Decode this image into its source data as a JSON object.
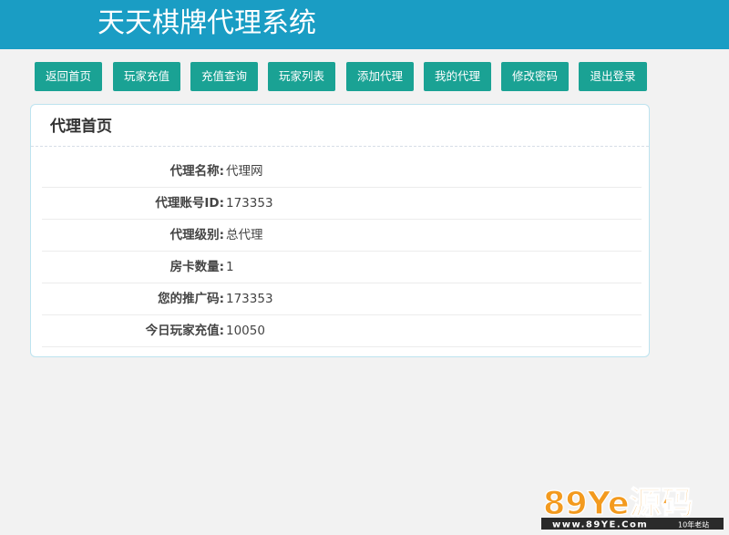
{
  "header": {
    "title": "天天棋牌代理系统"
  },
  "nav": {
    "items": [
      {
        "label": "返回首页"
      },
      {
        "label": "玩家充值"
      },
      {
        "label": "充值查询"
      },
      {
        "label": "玩家列表"
      },
      {
        "label": "添加代理"
      },
      {
        "label": "我的代理"
      },
      {
        "label": "修改密码"
      },
      {
        "label": "退出登录"
      }
    ]
  },
  "panel": {
    "title": "代理首页",
    "rows": [
      {
        "label": "代理名称:",
        "value": "代理网"
      },
      {
        "label": "代理账号ID:",
        "value": "173353"
      },
      {
        "label": "代理级别:",
        "value": "总代理"
      },
      {
        "label": "房卡数量:",
        "value": "1"
      },
      {
        "label": "您的推广码:",
        "value": "173353"
      },
      {
        "label": "今日玩家充值:",
        "value": "10050"
      }
    ]
  },
  "watermark": {
    "logo": "89Ye源码",
    "url": "www.89YE.Com",
    "tag": "10年老站"
  },
  "colors": {
    "header_bg": "#1a9dc4",
    "nav_button_bg": "#1aa294",
    "page_bg": "#f2f2f2",
    "panel_border": "#bde3ef"
  }
}
